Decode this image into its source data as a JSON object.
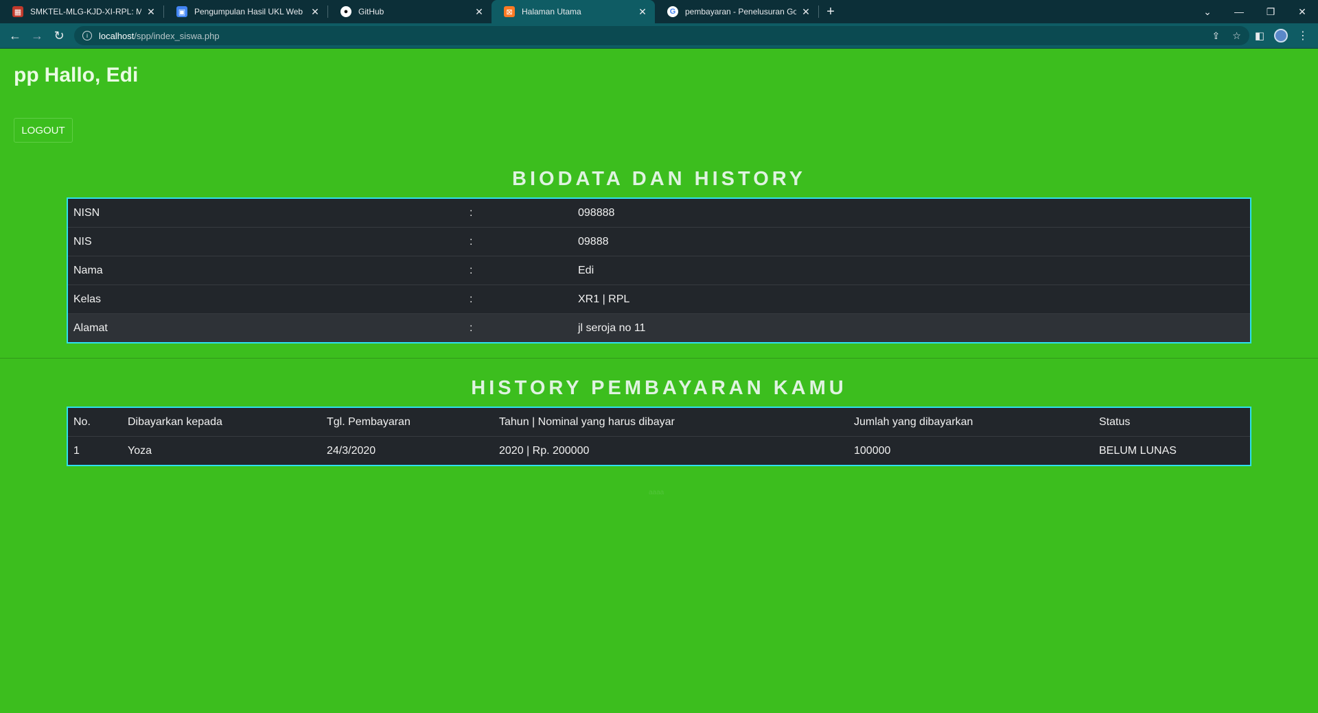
{
  "browser": {
    "tabs": [
      {
        "title": "SMKTEL-MLG-KJD-XI-RPL: Modu",
        "icon": "moodle-icon",
        "active": false
      },
      {
        "title": "Pengumpulan Hasil UKL Web",
        "icon": "classroom-icon",
        "active": false
      },
      {
        "title": "GitHub",
        "icon": "github-icon",
        "active": false
      },
      {
        "title": "Halaman Utama",
        "icon": "xampp-icon",
        "active": true
      },
      {
        "title": "pembayaran - Penelusuran Goog",
        "icon": "google-icon",
        "active": false
      }
    ],
    "url_host": "localhost",
    "url_path": "/spp/index_siswa.php"
  },
  "header": {
    "broken_image_alt": "pp",
    "greeting": "Hallo, Edi",
    "logout_label": "LOGOUT"
  },
  "biodata": {
    "title": "BIODATA DAN HISTORY",
    "rows": [
      {
        "label": "NISN",
        "sep": ":",
        "value": "098888"
      },
      {
        "label": "NIS",
        "sep": ":",
        "value": "09888"
      },
      {
        "label": "Nama",
        "sep": ":",
        "value": "Edi"
      },
      {
        "label": "Kelas",
        "sep": ":",
        "value": "XR1 | RPL"
      },
      {
        "label": "Alamat",
        "sep": ":",
        "value": "jl seroja no 11"
      }
    ]
  },
  "history": {
    "title": "HISTORY PEMBAYARAN KAMU",
    "headers": [
      "No.",
      "Dibayarkan kepada",
      "Tgl. Pembayaran",
      "Tahun | Nominal yang harus dibayar",
      "Jumlah yang dibayarkan",
      "Status"
    ],
    "rows": [
      [
        "1",
        "Yoza",
        "24/3/2020",
        "2020 | Rp. 200000",
        "100000",
        "BELUM LUNAS"
      ]
    ]
  },
  "footer": {
    "text": "aaaa"
  },
  "colors": {
    "page_bg": "#3cbe1e",
    "table_bg": "#22262b",
    "table_border": "#2ee0f0"
  }
}
